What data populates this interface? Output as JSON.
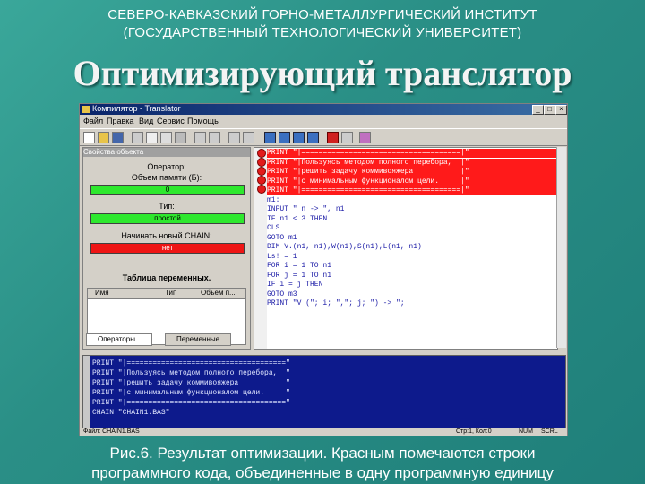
{
  "header": {
    "line1": "СЕВЕРО-КАВКАЗСКИЙ ГОРНО-МЕТАЛЛУРГИЧЕСКИЙ ИНСТИТУТ",
    "line2": "(ГОСУДАРСТВЕННЫЙ ТЕХНОЛОГИЧЕСКИЙ УНИВЕРСИТЕТ)"
  },
  "slide_title": "Оптимизирующий транслятор",
  "caption": {
    "line1": "Рис.6. Результат оптимизации. Красным помечаются строки",
    "line2": "программного кода, объединенные в одну программную единицу"
  },
  "window": {
    "title": "Компилятор - Translator",
    "menu": [
      "Файл",
      "Правка",
      "Вид",
      "Сервис",
      "Помощь"
    ],
    "left_panel": {
      "title": "Свойства объекта",
      "operator_label": "Оператор:",
      "byte_size_label": "Объем памяти (Б):",
      "byte_size_value": "0",
      "type_label": "Тип:",
      "type_value": "простой",
      "new_chain_label": "Начинать новый CHAIN:",
      "new_chain_value": "нет",
      "variables_table_title": "Таблица переменных.",
      "variables_columns": [
        "Имя",
        "Тип",
        "Объем п..."
      ],
      "tabs": [
        "Операторы",
        "Переменные"
      ]
    },
    "code_lines": [
      "PRINT \"|=====================================|\"",
      "PRINT \"|Пользуясь методом полного перебора,  |\"",
      "PRINT \"|решить задачу коммивояжера           |\"",
      "PRINT \"|с минимальным функционалом цели.     |\"",
      "PRINT \"|=====================================|\"",
      "m1:",
      "INPUT \" n -> \", n1",
      "IF n1 < 3 THEN",
      "CLS",
      "GOTO m1",
      "DIM V.(n1, n1),W(n1),S(n1),L(n1, n1)",
      "Ls! = 1",
      "FOR i = 1 TO n1",
      "FOR j = 1 TO n1",
      "IF i = j THEN",
      "GOTO m3",
      "PRINT \"V (\"; i; \",\"; j; \") -> \";"
    ],
    "output_lines": [
      "PRINT \"|=====================================\"",
      "PRINT \"|Пользуясь методом полного перебора,  \"",
      "PRINT \"|решить задачу коммивояжера           \"",
      "PRINT \"|с минимальным функционалом цели.     \"",
      "PRINT \"|=====================================\"",
      "CHAIN \"CHAIN1.BAS\""
    ],
    "status": {
      "file": "Файл: CHAIN1.BAS",
      "pos": "Стр:1, Кол:0",
      "num": "NUM",
      "scrl": "SCRL"
    }
  },
  "colors": {
    "highlight": "#ff1a1a",
    "ok": "#2ee82e",
    "background": "#2a8f86"
  }
}
